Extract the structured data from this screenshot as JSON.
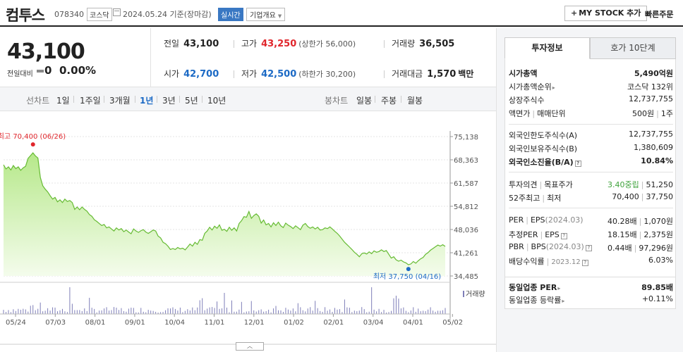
{
  "header": {
    "stock_name": "컴투스",
    "stock_code": "078340",
    "market": "코스닥",
    "date": "2024.05.24",
    "date_suffix": "기준(장마감)",
    "realtime": "실시간",
    "company_overview": "기업개요",
    "mystock_plus": "+",
    "mystock_button": "MY STOCK 추가",
    "quick_order": "빠른주문"
  },
  "price": {
    "current": "43,100",
    "change_label": "전일대비",
    "change_value": "0",
    "change_rate": "0.00%",
    "prev_close_label": "전일",
    "prev_close": "43,100",
    "high_label": "고가",
    "high": "43,250",
    "upper_limit_label": "(상한가",
    "upper_limit": "56,000)",
    "volume_label": "거래량",
    "volume": "36,505",
    "open_label": "시가",
    "open": "42,700",
    "low_label": "저가",
    "low": "42,500",
    "lower_limit_label": "(하한가",
    "lower_limit": "30,200)",
    "amount_label": "거래대금",
    "amount": "1,570",
    "amount_unit": "백만"
  },
  "periods": {
    "line_chart_label": "선차트",
    "line_options": [
      "1일",
      "1주일",
      "3개월",
      "1년",
      "3년",
      "5년",
      "10년"
    ],
    "active": "1년",
    "candle_chart_label": "봉차트",
    "candle_options": [
      "일봉",
      "주봉",
      "월봉"
    ]
  },
  "chart_data": {
    "type": "area",
    "y_ticks": [
      "75,138",
      "68,363",
      "61,587",
      "54,812",
      "48,036",
      "41,261",
      "34,485"
    ],
    "ylim": [
      34485,
      75138
    ],
    "x_ticks": [
      "05/24",
      "07/03",
      "08/01",
      "09/01",
      "10/04",
      "11/01",
      "12/01",
      "01/02",
      "02/01",
      "03/04",
      "04/01",
      "05/02"
    ],
    "high_annotation": "최고 70,400 (06/26)",
    "low_annotation": "최저 37,750 (04/16)",
    "high_value": 70400,
    "low_value": 37750,
    "volume_legend": "거래량",
    "price_series": [
      66900,
      65700,
      66300,
      65400,
      66700,
      65800,
      66300,
      65300,
      66000,
      66500,
      68800,
      69600,
      70400,
      69500,
      68900,
      63200,
      60800,
      59800,
      59000,
      57900,
      56900,
      57400,
      56100,
      56700,
      55900,
      56900,
      56200,
      56500,
      55900,
      53900,
      54600,
      53800,
      54600,
      53900,
      53400,
      52400,
      51900,
      50900,
      50400,
      49800,
      49200,
      49500,
      48500,
      48800,
      48200,
      47600,
      48500,
      47900,
      48300,
      47400,
      47900,
      47300,
      46800,
      48200,
      47600,
      47200,
      47700,
      48000,
      47300,
      46900,
      47400,
      47900,
      47600,
      46100,
      45600,
      44300,
      43900,
      43200,
      42200,
      42500,
      42200,
      42800,
      42400,
      42600,
      42100,
      42900,
      43800,
      43200,
      44300,
      43700,
      45100,
      44900,
      46900,
      47600,
      48700,
      47900,
      49000,
      48400,
      49400,
      47800,
      48100,
      47500,
      48700,
      47800,
      48500,
      47600,
      49800,
      50600,
      51800,
      51600,
      53300,
      51300,
      52100,
      52600,
      51900,
      49900,
      50800,
      49400,
      49800,
      48800,
      50000,
      49200,
      50200,
      49100,
      48600,
      49900,
      49300,
      48900,
      48300,
      49100,
      48600,
      48000,
      49300,
      49800,
      48900,
      48400,
      48800,
      48200,
      48700,
      47900,
      48000,
      48500,
      48300,
      48800,
      48200,
      47500,
      46900,
      46100,
      45200,
      44300,
      43600,
      42900,
      42200,
      41400,
      40800,
      40100,
      41000,
      41200,
      40900,
      41500,
      41000,
      41800,
      41400,
      41600,
      42100,
      41600,
      41900,
      40800,
      39700,
      40100,
      39200,
      38800,
      39100,
      38600,
      38300,
      37750,
      38000,
      38700,
      38200,
      38900,
      39500,
      39900,
      40800,
      41300,
      42000,
      42500,
      43000,
      43500,
      43200,
      43600,
      43100
    ]
  },
  "info": {
    "tab_active": "투자정보",
    "tab_other": "호가 10단계",
    "market_cap_label": "시가총액",
    "market_cap": "5,490억원",
    "market_cap_rank_label": "시가총액순위",
    "market_cap_rank": "코스닥 132위",
    "shares_label": "상장주식수",
    "shares": "12,737,755",
    "par_label": "액면가",
    "unit_label": "매매단위",
    "par_value": "500원",
    "trade_unit": "1주",
    "foreign_limit_label": "외국인한도주식수(A)",
    "foreign_limit": "12,737,755",
    "foreign_hold_label": "외국인보유주식수(B)",
    "foreign_hold": "1,380,609",
    "foreign_rate_label": "외국인소진율(B/A)",
    "foreign_rate": "10.84%",
    "opinion_label": "투자의견",
    "target_label": "목표주가",
    "opinion": "3.40중립",
    "target": "51,250",
    "w52_high_label": "52주최고",
    "w52_low_label": "최저",
    "w52_high": "70,400",
    "w52_low": "37,750",
    "per_label": "PER",
    "eps_label": "EPS",
    "eps_period": "(2024.03)",
    "per": "40.28배",
    "eps": "1,070원",
    "est_per_label": "추정PER",
    "est_eps_label": "EPS",
    "est_per": "18.15배",
    "est_eps": "2,375원",
    "pbr_label": "PBR",
    "bps_label": "BPS",
    "bps_period": "(2024.03)",
    "pbr": "0.44배",
    "bps": "97,296원",
    "dividend_label": "배당수익률",
    "dividend_period": "2023.12",
    "dividend": "6.03%",
    "sector_per_label": "동일업종 PER",
    "sector_per": "89.85배",
    "sector_change_label": "동일업종 등락률",
    "sector_change": "+0.11%"
  }
}
